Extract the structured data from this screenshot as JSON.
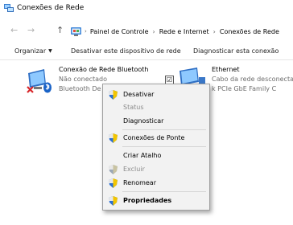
{
  "window": {
    "title": "Conexões de Rede",
    "title_icon": "network-connections-icon"
  },
  "address": {
    "back_glyph": "←",
    "forward_glyph": "→",
    "up_glyph": "↑",
    "lead_separator": "›",
    "breadcrumbs": [
      "Painel de Controle",
      "Rede e Internet",
      "Conexões de Rede"
    ],
    "separator": "›"
  },
  "toolbar": {
    "organize": "Organizar",
    "organize_caret": "▼",
    "disable": "Desativar este dispositivo de rede",
    "diagnose": "Diagnosticar esta conexão"
  },
  "connections": [
    {
      "name": "Conexão de Rede Bluetooth",
      "status": "Não conectado",
      "device": "Bluetooth De",
      "icon": "bluetooth-network-icon",
      "status_icon": "disconnected-x-icon"
    },
    {
      "name": "Ethernet",
      "status": "Cabo da rede desconectado",
      "device": "k PCIe GbE Family C",
      "icon": "ethernet-adapter-icon",
      "checked": "☑"
    }
  ],
  "context_menu": {
    "items": [
      {
        "label": "Desativar",
        "enabled": true,
        "bold": false,
        "icon": "shield-icon"
      },
      {
        "label": "Status",
        "enabled": false,
        "bold": false,
        "icon": null
      },
      {
        "label": "Diagnosticar",
        "enabled": true,
        "bold": false,
        "icon": null
      },
      {
        "label": "Conexões de Ponte",
        "enabled": true,
        "bold": false,
        "icon": "shield-icon"
      },
      {
        "label": "Criar Atalho",
        "enabled": true,
        "bold": false,
        "icon": null
      },
      {
        "label": "Excluir",
        "enabled": false,
        "bold": false,
        "icon": "shield-icon"
      },
      {
        "label": "Renomear",
        "enabled": true,
        "bold": false,
        "icon": "shield-icon"
      },
      {
        "label": "Propriedades",
        "enabled": true,
        "bold": true,
        "icon": "shield-icon"
      }
    ]
  },
  "colors": {
    "window_bg": "#ffffff",
    "menu_bg": "#f2f2f2",
    "disabled_text": "#8a8a8a",
    "subtext": "#6d6d6d",
    "frame": "#2b2b2b"
  }
}
